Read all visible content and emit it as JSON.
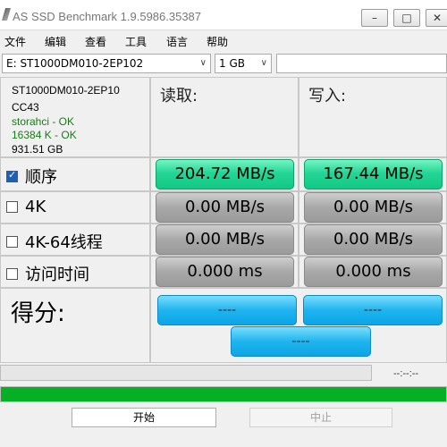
{
  "window": {
    "title": "AS SSD Benchmark 1.9.5986.35387",
    "min": "–",
    "max": "□",
    "close": "✕"
  },
  "menu": [
    "文件",
    "编辑",
    "查看",
    "工具",
    "语言",
    "帮助"
  ],
  "toolbar": {
    "drive": "E: ST1000DM010-2EP102",
    "size": "1 GB",
    "arrow": "∨"
  },
  "drive_info": {
    "model": "ST1000DM010-2EP10",
    "firmware": "CC43",
    "driver": "storahci - OK",
    "alignment": "16384 K - OK",
    "capacity": "931.51 GB"
  },
  "columns": {
    "read": "读取:",
    "write": "写入:"
  },
  "rows": [
    {
      "label": "顺序",
      "checked": true,
      "read": "204.72 MB/s",
      "write": "167.44 MB/s"
    },
    {
      "label": "4K",
      "checked": false,
      "read": "0.00 MB/s",
      "write": "0.00 MB/s"
    },
    {
      "label": "4K-64线程",
      "checked": false,
      "read": "0.00 MB/s",
      "write": "0.00 MB/s"
    },
    {
      "label": "访问时间",
      "checked": false,
      "read": "0.000 ms",
      "write": "0.000 ms"
    }
  ],
  "score": {
    "label": "得分:",
    "read": "----",
    "write": "----",
    "total": "----"
  },
  "status": {
    "time": "--:--:--",
    "progress_fraction": 0.0,
    "overall_progress_fraction": 1.0
  },
  "buttons": {
    "start": "开始",
    "stop": "中止"
  },
  "colors": {
    "good": "#24d696",
    "idle": "#a8a8a8",
    "score": "#1fb4ef",
    "progress": "#06b025"
  }
}
